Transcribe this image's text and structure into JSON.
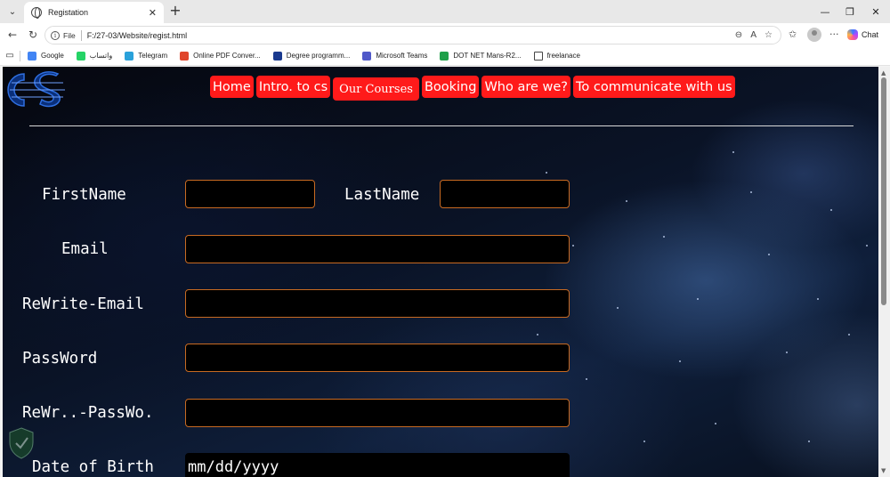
{
  "browser": {
    "tab_title": "Registation",
    "tab_close": "✕",
    "new_tab": "+",
    "window_controls": {
      "minimize": "—",
      "maximize": "❐",
      "close": "✕"
    },
    "file_chip": "File",
    "url": "F:/27-03/Website/regist.html",
    "chat_label": "Chat",
    "bookmarks": [
      {
        "label": "Google",
        "color": "#4285f4"
      },
      {
        "label": "واتساب",
        "color": "#25d366"
      },
      {
        "label": "Telegram",
        "color": "#2aa1da"
      },
      {
        "label": "Online PDF Conver...",
        "color": "#e0452b"
      },
      {
        "label": "Degree programm...",
        "color": "#1a3a8f"
      },
      {
        "label": "Microsoft Teams",
        "color": "#5059c9"
      },
      {
        "label": "DOT NET Mans-R2...",
        "color": "#1fa04a"
      },
      {
        "label": "freelanace",
        "color": "#ffffff"
      }
    ]
  },
  "page": {
    "logo_alt": "CS",
    "nav": [
      {
        "label": "Home"
      },
      {
        "label": "Intro. to cs"
      },
      {
        "label": "Our Courses"
      },
      {
        "label": "Booking"
      },
      {
        "label": "Who are we?"
      },
      {
        "label": "To communicate with us"
      }
    ],
    "form": {
      "first_name_label": "FirstName",
      "last_name_label": "LastName",
      "email_label": "Email",
      "rewrite_email_label": "ReWrite-Email",
      "password_label": "PassWord",
      "rewrite_password_label": "ReWr..-PassWo.",
      "dob_label": "Date of Birth",
      "dob_placeholder": "mm/dd/yyyy"
    }
  }
}
